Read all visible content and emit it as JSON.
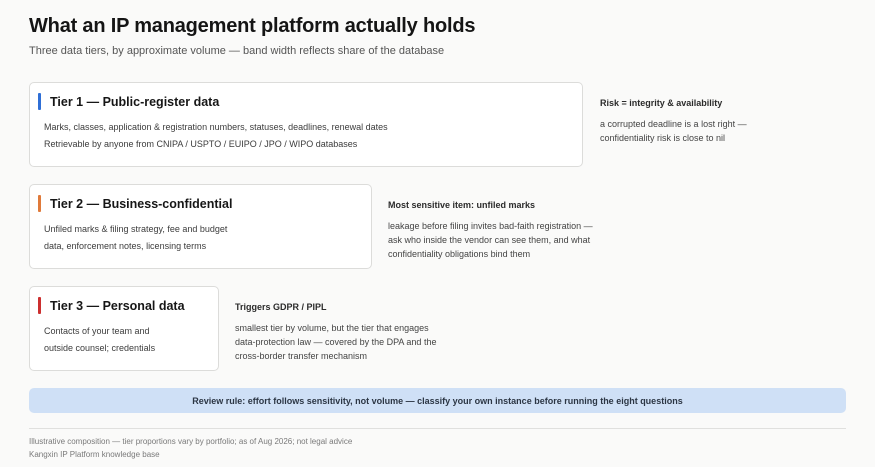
{
  "header": {
    "title": "What an IP management platform actually holds",
    "subtitle": "Three data tiers, by approximate volume — band width reflects share of the database"
  },
  "tiers": [
    {
      "heading": "Tier 1 — Public-register data",
      "accent": "#2f6fd6",
      "lines": [
        "Marks, classes, application & registration numbers, statuses, deadlines, renewal dates",
        "Retrievable by anyone from CNIPA / USPTO / EUIPO / JPO / WIPO databases"
      ],
      "note": {
        "title": "Risk = integrity & availability",
        "lines": [
          "a corrupted deadline is a lost right —",
          "confidentiality risk is close to nil"
        ]
      }
    },
    {
      "heading": "Tier 2 — Business-confidential",
      "accent": "#e07a3a",
      "lines": [
        "Unfiled marks & filing strategy, fee and budget",
        "data, enforcement notes, licensing terms"
      ],
      "note": {
        "title": "Most sensitive item: unfiled marks",
        "lines": [
          "leakage before filing invites bad-faith registration —",
          "ask who inside the vendor can see them, and what",
          "confidentiality obligations bind them"
        ]
      }
    },
    {
      "heading": "Tier 3 — Personal data",
      "accent": "#cc2f2f",
      "lines": [
        "Contacts of your team and",
        "outside counsel; credentials"
      ],
      "note": {
        "title": "Triggers GDPR / PIPL",
        "lines": [
          "smallest tier by volume, but the tier that engages",
          "data-protection law — covered by the DPA and the",
          "cross-border transfer mechanism"
        ]
      }
    }
  ],
  "review_rule": "Review rule: effort follows sensitivity, not volume — classify your own instance before running the eight questions",
  "footer": {
    "disclaimer": "Illustrative composition — tier proportions vary by portfolio; as of Aug 2026; not legal advice",
    "source": "Kangxin IP Platform knowledge base"
  }
}
